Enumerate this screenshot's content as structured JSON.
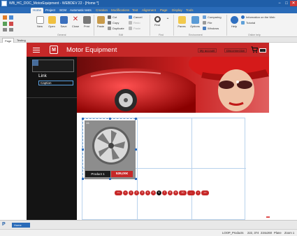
{
  "window": {
    "title": "WB_HC_DOC_MotorEquipment - WEBDEV 22 - [Home *]",
    "controls": [
      "−",
      "□",
      "✕"
    ]
  },
  "ribbon_tabs": [
    "Home",
    "Project",
    "SCM",
    "Automatic tests",
    "Creation",
    "Modifications",
    "Text",
    "Alignment",
    "Page",
    "Display",
    "Tools"
  ],
  "ribbon": {
    "new": "New",
    "open": "Open",
    "save": "Save",
    "close": "Close",
    "print": "Print",
    "paste": "Paste",
    "cut": "Cut",
    "copy": "Copy",
    "duplicate": "Duplicate",
    "cancel": "Cancel",
    "redo": "Redo",
    "paste2": "Paste",
    "find": "Find",
    "panes": "Panes",
    "options": "Options",
    "comparing": "Comparing",
    "file": "File",
    "windows": "Windows",
    "help": "Help",
    "info_web": "Information on the Web",
    "tutorial": "Tutorial",
    "groups": [
      "General",
      "Edit",
      "Find",
      "Environment",
      "Online help"
    ]
  },
  "doc_tabs": [
    "Page",
    "Testing"
  ],
  "page": {
    "brand": "Motor Equipment",
    "logo_letter": "M",
    "my_account": "My account",
    "disconnect": "Disconnection",
    "menu_link": "Link",
    "menu_caption": "Caption",
    "product_num": "1/1",
    "product_label": "Product 1",
    "product_price": "539,00€",
    "pager": [
      "<<",
      "<",
      "1",
      "2",
      "3",
      "4",
      "5",
      "6",
      "7",
      "8",
      "9",
      "10",
      "...",
      ">",
      ">>"
    ],
    "pager_active_index": 7
  },
  "bottom_tabs": {
    "logo": "P",
    "home": "Home"
  },
  "status": {
    "control": "LOOP_Products",
    "coords": "222, 374",
    "size": "234x260",
    "mode": "Plane",
    "zoom": "Zoom 1"
  }
}
